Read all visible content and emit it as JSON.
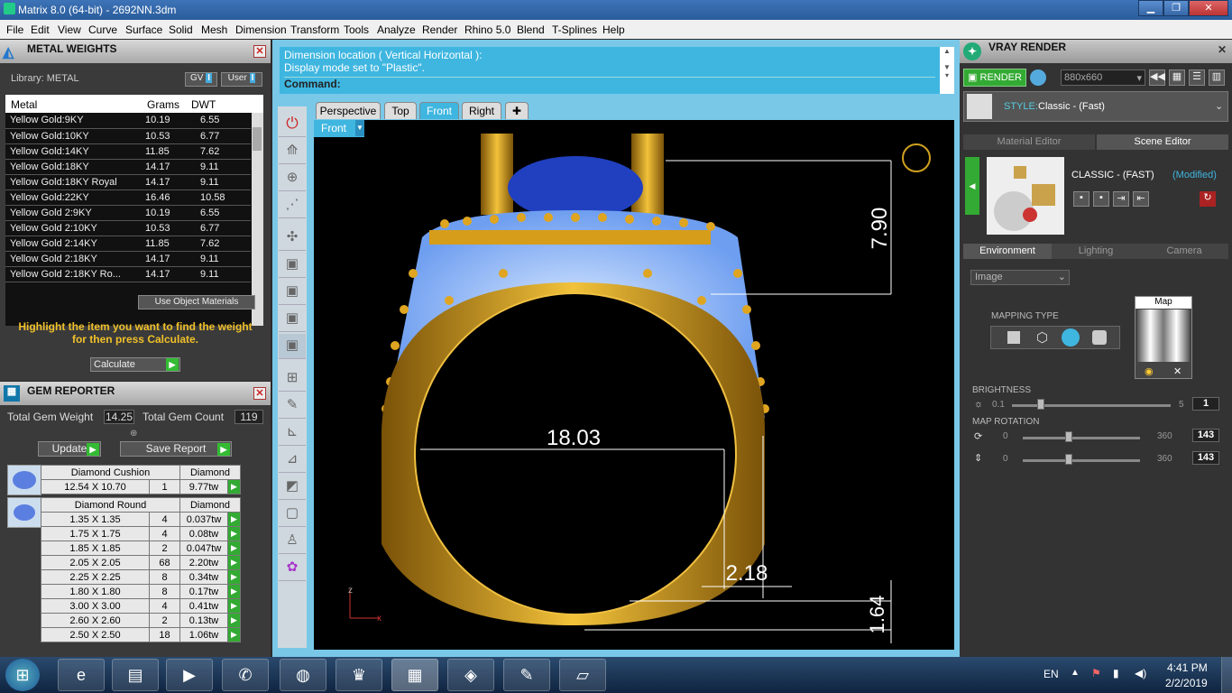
{
  "window": {
    "title": "Matrix 8.0 (64-bit) - 2692NN.3dm",
    "min": "▁",
    "max": "❐",
    "close": "✕"
  },
  "menu": [
    "File",
    "Edit",
    "View",
    "Curve",
    "Surface",
    "Solid",
    "Mesh",
    "Dimension",
    "Transform",
    "Tools",
    "Analyze",
    "Render",
    "Rhino 5.0",
    "Blend",
    "T-Splines",
    "Help"
  ],
  "metal": {
    "title": "METAL WEIGHTS",
    "library": "Library: METAL",
    "gv": "GV",
    "user": "User",
    "headers": [
      "Metal",
      "Grams",
      "DWT"
    ],
    "rows": [
      [
        "Yellow Gold:9KY",
        "10.19",
        "6.55"
      ],
      [
        "Yellow Gold:10KY",
        "10.53",
        "6.77"
      ],
      [
        "Yellow Gold:14KY",
        "11.85",
        "7.62"
      ],
      [
        "Yellow Gold:18KY",
        "14.17",
        "9.11"
      ],
      [
        "Yellow Gold:18KY Royal",
        "14.17",
        "9.11"
      ],
      [
        "Yellow Gold:22KY",
        "16.46",
        "10.58"
      ],
      [
        "Yellow Gold 2:9KY",
        "10.19",
        "6.55"
      ],
      [
        "Yellow Gold 2:10KY",
        "10.53",
        "6.77"
      ],
      [
        "Yellow Gold 2:14KY",
        "11.85",
        "7.62"
      ],
      [
        "Yellow Gold 2:18KY",
        "14.17",
        "9.11"
      ],
      [
        "Yellow Gold 2:18KY Ro...",
        "14.17",
        "9.11"
      ]
    ],
    "use_object": "Use Object Materials",
    "hint": "Highlight the item you want to find the weight for then press Calculate.",
    "calculate": "Calculate"
  },
  "gem": {
    "title": "GEM REPORTER",
    "total_weight_label": "Total Gem Weight",
    "total_weight": "14.25",
    "total_count_label": "Total Gem Count",
    "total_count": "119",
    "update": "Update",
    "save": "Save Report",
    "group1": {
      "name": "Diamond Cushion",
      "type": "Diamond",
      "rows": [
        [
          "12.54 X 10.70",
          "1",
          "9.77tw"
        ]
      ]
    },
    "group2": {
      "name": "Diamond Round",
      "type": "Diamond",
      "rows": [
        [
          "1.35 X 1.35",
          "4",
          "0.037tw"
        ],
        [
          "1.75 X 1.75",
          "4",
          "0.08tw"
        ],
        [
          "1.85 X 1.85",
          "2",
          "0.047tw"
        ],
        [
          "2.05 X 2.05",
          "68",
          "2.20tw"
        ],
        [
          "2.25 X 2.25",
          "8",
          "0.34tw"
        ],
        [
          "1.80 X 1.80",
          "8",
          "0.17tw"
        ],
        [
          "3.00 X 3.00",
          "4",
          "0.41tw"
        ],
        [
          "2.60 X 2.60",
          "2",
          "0.13tw"
        ],
        [
          "2.50 X 2.50",
          "18",
          "1.06tw"
        ]
      ]
    }
  },
  "command": {
    "line1": "Dimension location ( Vertical  Horizontal ):",
    "line2": "Display mode set to \"Plastic\".",
    "prompt": "Command:"
  },
  "tabs": {
    "perspective": "Perspective",
    "top": "Top",
    "front": "Front",
    "right": "Right",
    "add": "✚",
    "viewport_label": "Front"
  },
  "dims": {
    "top": "7.90",
    "width": "18.03",
    "band": "2.18",
    "bottom": "1.64",
    "axis_z": "z",
    "axis_x": "x"
  },
  "vray": {
    "title": "VRAY RENDER",
    "render": "RENDER",
    "size": "880x660",
    "style_label": "STYLE:",
    "style_value": "Classic - (Fast)",
    "tab_material": "Material Editor",
    "tab_scene": "Scene Editor",
    "preset": "CLASSIC - (FAST)",
    "modified": "(Modified)",
    "env_tab": "Environment",
    "light_tab": "Lighting",
    "camera_tab": "Camera",
    "image": "Image",
    "mapping": "MAPPING TYPE",
    "map": "Map",
    "brightness_label": "BRIGHTNESS",
    "b_min": "0.1",
    "b_max": "5",
    "b_val": "1",
    "rotation_label": "MAP ROTATION",
    "r1_min": "0",
    "r1_max": "360",
    "r1_val": "143",
    "r2_min": "0",
    "r2_max": "360",
    "r2_val": "143"
  },
  "taskbar": {
    "lang": "EN",
    "time": "4:41 PM",
    "date": "2/2/2019"
  },
  "colors": {
    "gold": "#d9a21f",
    "gem": "#8ab4ff",
    "accent": "#3fb6e0"
  }
}
